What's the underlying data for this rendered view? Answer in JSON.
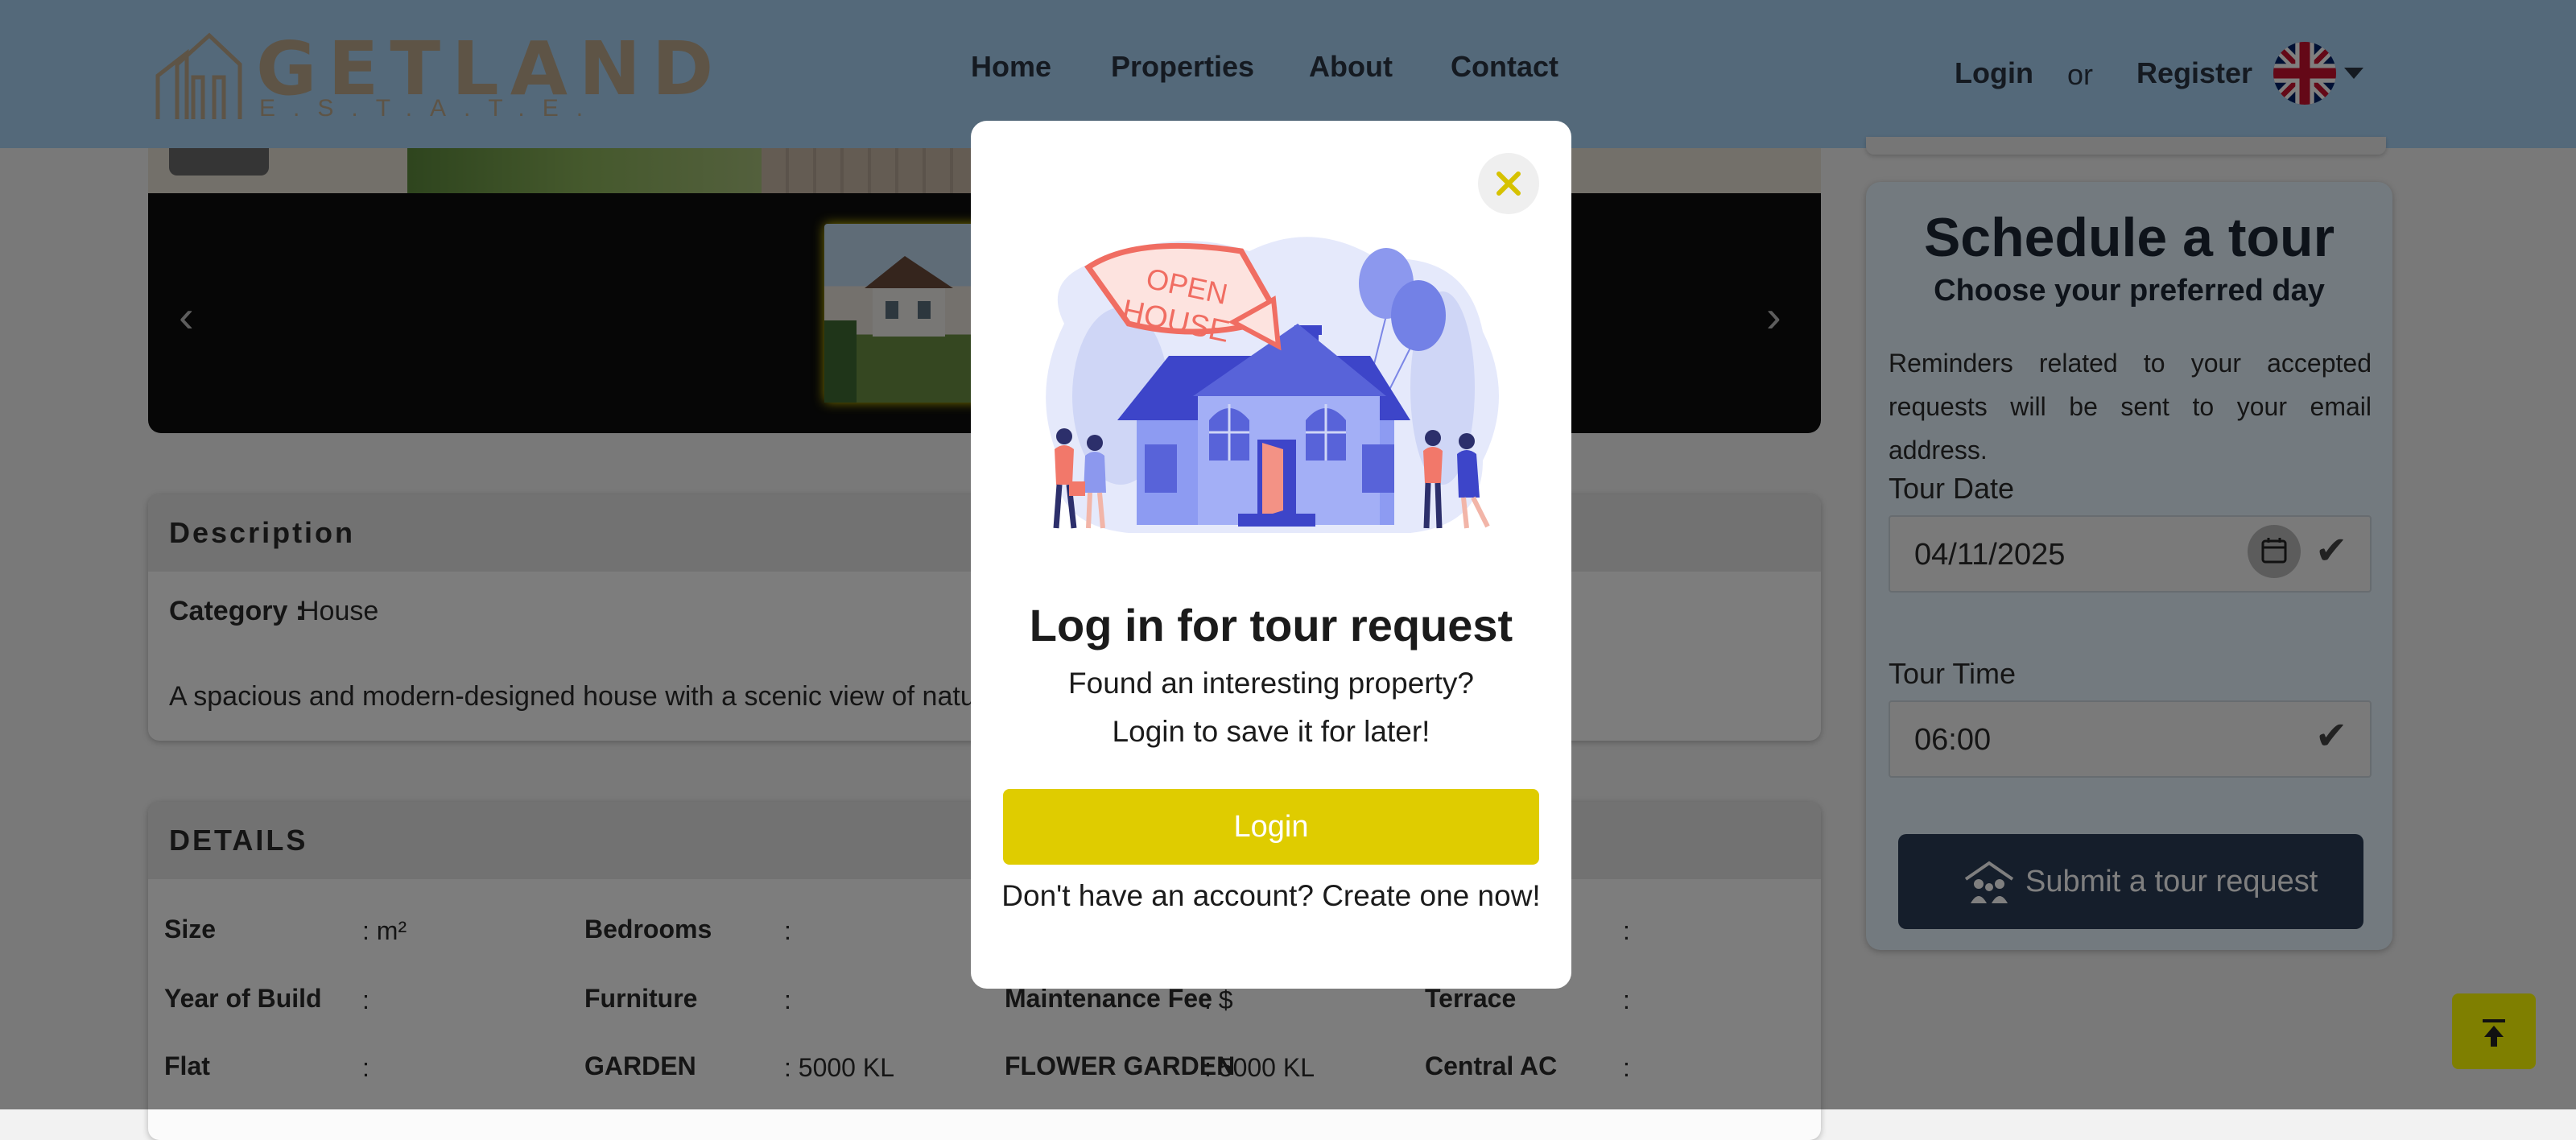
{
  "header": {
    "logo_word": "GETLAND",
    "logo_sub": "E.S.T.A.T.E.",
    "nav": [
      "Home",
      "Properties",
      "About",
      "Contact"
    ],
    "login": "Login",
    "or": "or",
    "register": "Register"
  },
  "description": {
    "heading": "Description",
    "category_label": "Category :",
    "category_value": "House",
    "text": "A spacious and modern-designed house with a scenic view of nature"
  },
  "details": {
    "heading": "DETAILS",
    "rows": [
      [
        "Size",
        ": m²",
        "Bedrooms",
        ":",
        "",
        "",
        "",
        ":"
      ],
      [
        "Year of Build",
        ":",
        "Furniture",
        ":",
        "Maintenance Fee",
        ": $",
        "Terrace",
        ":"
      ],
      [
        "Flat",
        ":",
        "GARDEN",
        ": 5000 KL",
        "FLOWER GARDEN",
        ": 5000 KL",
        "Central AC",
        ":"
      ]
    ]
  },
  "tour": {
    "title": "Schedule a tour",
    "subtitle": "Choose your preferred day",
    "reminder": "Reminders related to your accepted requests will be sent to your email address.",
    "date_label": "Tour Date",
    "date_value": "04/11/2025",
    "time_label": "Tour Time",
    "time_value": "06:00",
    "submit": "Submit a tour request"
  },
  "modal": {
    "badge_line1": "OPEN",
    "badge_line2": "HOUSE",
    "title": "Log in for tour request",
    "line1": "Found an interesting property?",
    "line2": "Login to save it for later!",
    "login_button": "Login",
    "create": "Don't have an account? Create one now!"
  },
  "colors": {
    "accent_yellow": "#dfcc00",
    "header_bg": "#a9d3f5",
    "submit_bg": "#2b3c57"
  },
  "icons": [
    "logo-icon",
    "uk-flag-icon",
    "caret-down-icon",
    "chevron-left-icon",
    "chevron-right-icon",
    "calendar-icon",
    "check-icon",
    "people-house-icon",
    "arrow-up-icon",
    "close-icon"
  ]
}
